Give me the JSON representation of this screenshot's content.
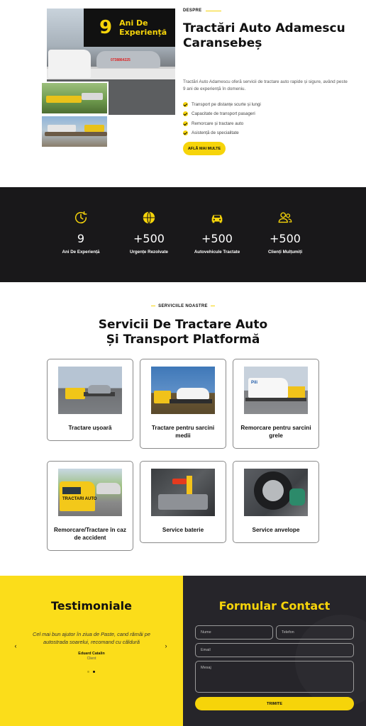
{
  "about": {
    "experience_number": "9",
    "experience_text": "Ani De Experiență",
    "kicker": "DESPRE",
    "title": "Tractări Auto Adamescu Caransebeș",
    "description": "Tractări Auto Adamescu oferă servicii de tractare auto rapide și sigure, având peste 9 ani de experiență în domeniu.",
    "features": [
      "Transport pe distanțe scurte și lungi",
      "Capacitate de transport pasageri",
      "Remorcare și tractare auto",
      "Asistență de specialitate"
    ],
    "button_label": "AFLĂ MAI MULTE",
    "truck_phone": "0738864225"
  },
  "stats": [
    {
      "icon": "clock-icon",
      "value": "9",
      "label": "Ani De Experiență"
    },
    {
      "icon": "globe-icon",
      "value": "+500",
      "label": "Urgențe Rezolvate"
    },
    {
      "icon": "car-icon",
      "value": "+500",
      "label": "Autovehicule Tractate"
    },
    {
      "icon": "users-icon",
      "value": "+500",
      "label": "Clienți Mulțumiți"
    }
  ],
  "services": {
    "kicker": "SERVICIILE NOASTRE",
    "title": "Servicii De Tractare Auto Și Transport Platformă",
    "cards": [
      {
        "title": "Tractare ușoară"
      },
      {
        "title": "Tractare pentru sarcini medii"
      },
      {
        "title": "Remorcare pentru sarcini grele"
      },
      {
        "title": "Remorcare/Tractare în caz de accident"
      },
      {
        "title": "Service baterie"
      },
      {
        "title": "Service anvelope"
      }
    ]
  },
  "testimonials": {
    "title": "Testimoniale",
    "quote": "Cel mai bun ajutor în ziua de Paste, cand rămâi pe autostrada soarelui, recomand cu căldură",
    "author": "Eduard Catalin",
    "role": "Client"
  },
  "contact": {
    "title": "Formular Contact",
    "name_placeholder": "Nume",
    "phone_placeholder": "Telefon",
    "email_placeholder": "Email",
    "message_placeholder": "Mesaj",
    "submit_label": "TRIMITE"
  },
  "colors": {
    "accent": "#f6d40a",
    "dark": "#19181a",
    "contact_bg": "#26252a",
    "testimonial_bg": "#fbdd1a"
  }
}
